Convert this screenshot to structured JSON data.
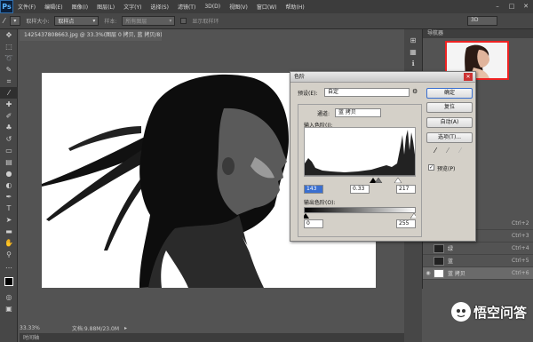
{
  "menubar": {
    "logo": "Ps",
    "items": [
      "文件(F)",
      "编辑(E)",
      "图像(I)",
      "图层(L)",
      "文字(Y)",
      "选择(S)",
      "滤镜(T)",
      "3D(D)",
      "视图(V)",
      "窗口(W)",
      "帮助(H)"
    ]
  },
  "optbar": {
    "sample_size_label": "取样大小:",
    "sample_size_value": "取样点",
    "sample_label": "样本:",
    "sample_value": "所有图层",
    "show_ring_label": "显示取样环",
    "workspace_value": "3D"
  },
  "document": {
    "tab_title": "1425437808663.jpg @ 33.3%(图层 0 拷贝, 蓝 拷贝/8) *",
    "zoom": "33.33%",
    "doc_info": "文档:9.88M/23.0M",
    "timeline_label": "时间轴"
  },
  "panels": {
    "navigator_title": "导航器",
    "channels": [
      {
        "name": "RGB",
        "shortcut": "Ctrl+2",
        "visible": true
      },
      {
        "name": "红",
        "shortcut": "Ctrl+3",
        "visible": false
      },
      {
        "name": "绿",
        "shortcut": "Ctrl+4",
        "visible": false
      },
      {
        "name": "蓝",
        "shortcut": "Ctrl+5",
        "visible": false
      },
      {
        "name": "蓝 拷贝",
        "shortcut": "Ctrl+6",
        "visible": true,
        "active": true
      }
    ]
  },
  "levels_dialog": {
    "title": "色阶",
    "preset_label": "预设(E):",
    "preset_value": "自定",
    "channel_label": "通道:",
    "channel_value": "蓝 拷贝",
    "input_label": "输入色阶(I):",
    "input_black": "143",
    "input_gamma": "0.33",
    "input_white": "217",
    "output_label": "输出色阶(O):",
    "output_black": "0",
    "output_white": "255",
    "buttons": {
      "ok": "确定",
      "reset": "复位",
      "auto": "自动(A)",
      "options": "选项(T)..."
    },
    "preview_label": "预览(P)",
    "preview_checked": true
  },
  "watermark": {
    "text": "悟空问答"
  }
}
